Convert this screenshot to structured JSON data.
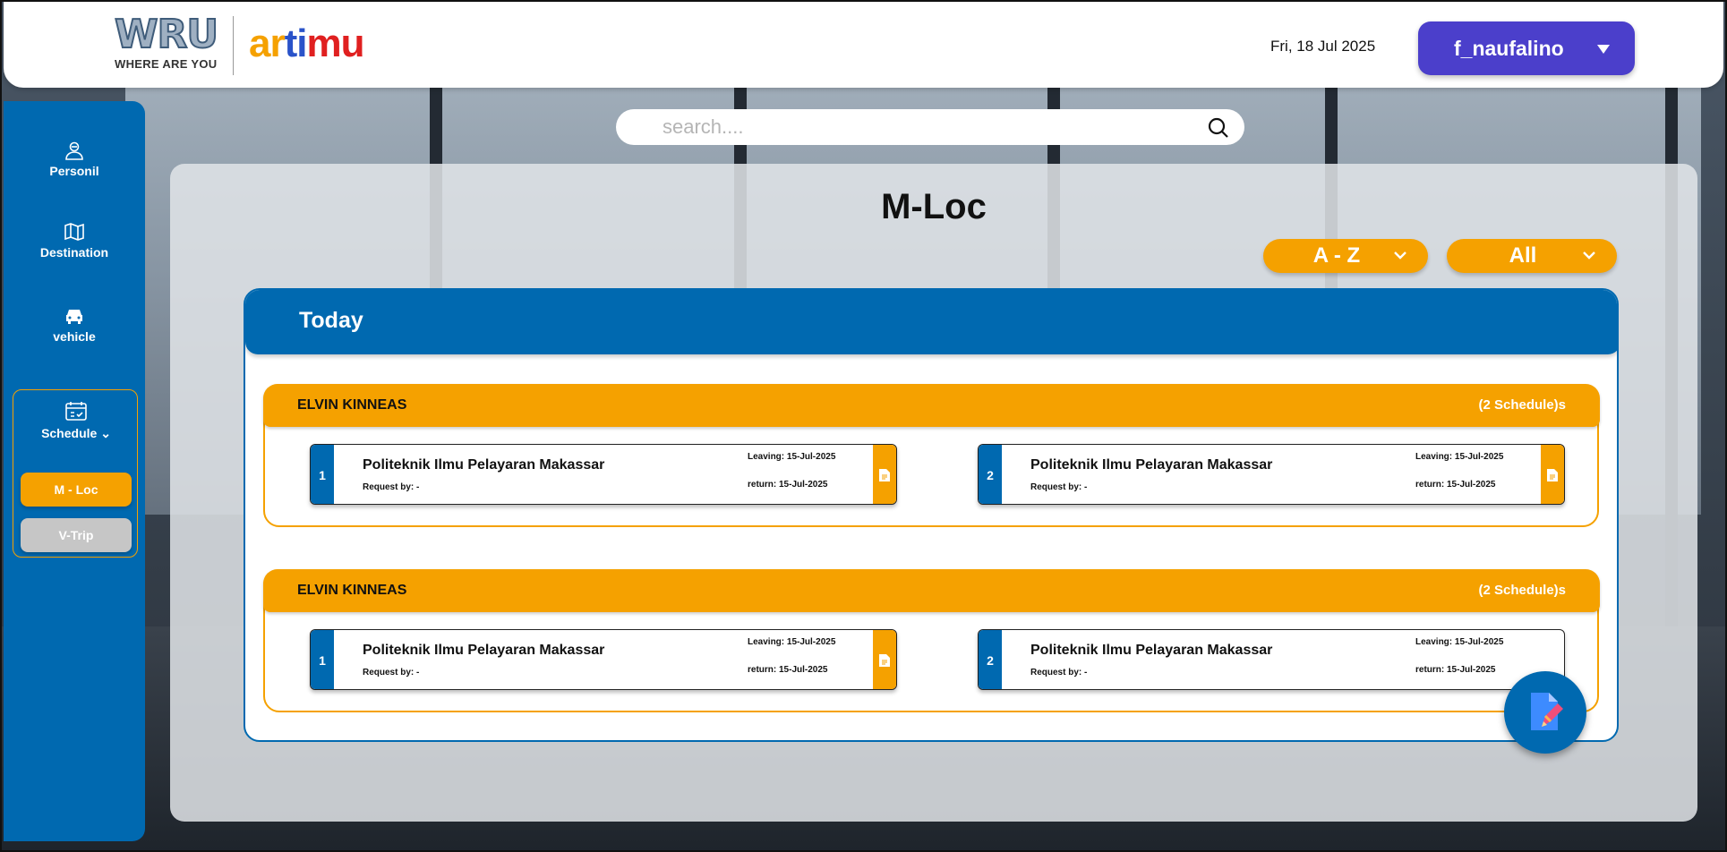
{
  "header": {
    "logo_wru": "WRU",
    "logo_wru_sub": "WHERE ARE YOU",
    "logo_artimu_1": "ar",
    "logo_artimu_2": "ti",
    "logo_artimu_3": "mu",
    "date": "Fri, 18 Jul 2025",
    "user": "f_naufalino"
  },
  "sidebar": {
    "items": [
      {
        "label": "Personil",
        "icon": "person-icon"
      },
      {
        "label": "Destination",
        "icon": "map-icon"
      },
      {
        "label": "vehicle",
        "icon": "car-icon"
      }
    ],
    "schedule": {
      "label": "Schedule",
      "icon": "calendar-icon",
      "sub_items": [
        {
          "label": "M - Loc",
          "active": true
        },
        {
          "label": "V-Trip",
          "active": false
        }
      ]
    }
  },
  "search": {
    "placeholder": "search...."
  },
  "main": {
    "title": "M-Loc",
    "sort_filter": "A - Z",
    "category_filter": "All",
    "section_title": "Today",
    "groups": [
      {
        "name": "ELVIN KINNEAS",
        "count_label": "(2 Schedule)s",
        "schedules": [
          {
            "number": "1",
            "place": "Politeknik Ilmu Pelayaran Makassar",
            "request": "Request by: -",
            "leaving": "Leaving: 15-Jul-2025",
            "return": "return: 15-Jul-2025",
            "has_doc": true
          },
          {
            "number": "2",
            "place": "Politeknik Ilmu Pelayaran Makassar",
            "request": "Request by: -",
            "leaving": "Leaving: 15-Jul-2025",
            "return": "return: 15-Jul-2025",
            "has_doc": true
          }
        ]
      },
      {
        "name": "ELVIN KINNEAS",
        "count_label": "(2 Schedule)s",
        "schedules": [
          {
            "number": "1",
            "place": "Politeknik Ilmu Pelayaran Makassar",
            "request": "Request by: -",
            "leaving": "Leaving: 15-Jul-2025",
            "return": "return: 15-Jul-2025",
            "has_doc": true
          },
          {
            "number": "2",
            "place": "Politeknik Ilmu Pelayaran Makassar",
            "request": "Request by: -",
            "leaving": "Leaving: 15-Jul-2025",
            "return": "return: 15-Jul-2025",
            "has_doc": false
          }
        ]
      }
    ]
  },
  "fab": {
    "icon": "edit-document-icon"
  },
  "colors": {
    "primary": "#0069b0",
    "accent": "#f5a100",
    "user_button": "#4b3fcb"
  }
}
